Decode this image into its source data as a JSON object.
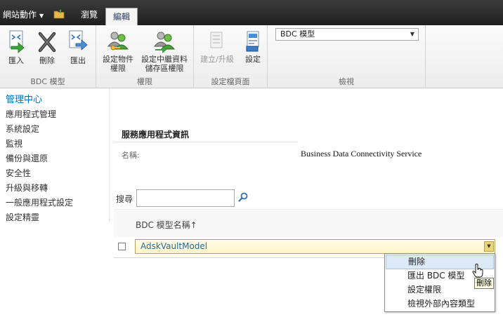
{
  "topbar": {
    "site_actions": "網站動作",
    "tab_browse": "瀏覽",
    "tab_edit": "編輯"
  },
  "ribbon": {
    "bdc_group": {
      "label": "BDC 模型",
      "import": "匯入",
      "delete": "刪除",
      "export": "匯出"
    },
    "perm_group": {
      "label": "權限",
      "set_object_line1": "設定物件",
      "set_object_line2": "權限",
      "set_store_line1": "設定中繼資料",
      "set_store_line2": "儲存區權限"
    },
    "profile_group": {
      "label": "設定檔頁面",
      "create_upgrade": "建立/升級",
      "settings": "設定"
    },
    "view_group": {
      "label": "檢視",
      "combo_value": "BDC 模型"
    }
  },
  "leftnav": {
    "heading": "管理中心",
    "items": [
      "應用程式管理",
      "系統設定",
      "監視",
      "備份與還原",
      "安全性",
      "升級與移轉",
      "一般應用程式設定",
      "設定精靈"
    ]
  },
  "main": {
    "section_title": "服務應用程式資訊",
    "name_label": "名稱:",
    "name_value": "Business Data Connectivity Service",
    "search_label": "搜尋",
    "search_value": "",
    "col_header": "BDC 模型名稱↑",
    "row_name": "AdskVaultModel"
  },
  "context_menu": {
    "items": [
      "刪除",
      "匯出 BDC 模型",
      "設定權限",
      "檢視外部內容類型"
    ],
    "tooltip": "刪除"
  }
}
